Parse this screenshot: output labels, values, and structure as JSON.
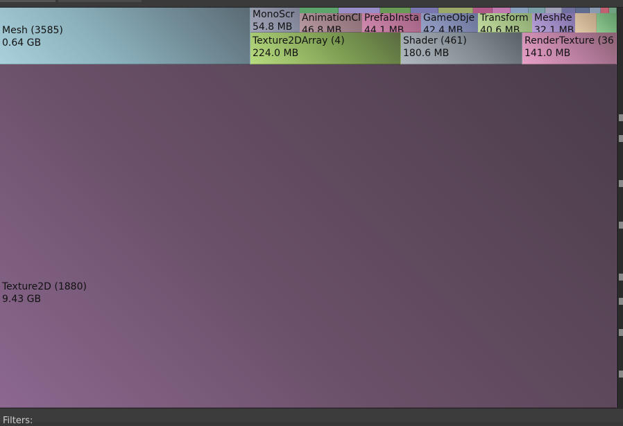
{
  "treemap": {
    "cells": {
      "texture2d": {
        "name": "Texture2D (1880)",
        "size": "9.43 GB"
      },
      "mesh": {
        "name": "Mesh (3585)",
        "size": "0.64 GB"
      },
      "monoscript": {
        "name": "MonoScr",
        "size": "54.8 MB"
      },
      "animationclip": {
        "name": "AnimationCl",
        "size": "46.8 MB"
      },
      "prefabinstance": {
        "name": "PrefabInsta",
        "size": "44.1 MB"
      },
      "gameobject": {
        "name": "GameObje",
        "size": "42.4 MB"
      },
      "transform": {
        "name": "Transform",
        "size": "40.6 MB"
      },
      "meshrenderer": {
        "name": "MeshRe",
        "size": "32.1 MB"
      },
      "texture2darray": {
        "name": "Texture2DArray (4)",
        "size": "224.0 MB"
      },
      "shader": {
        "name": "Shader (461)",
        "size": "180.6 MB"
      },
      "rendertexture": {
        "name": "RenderTexture (36",
        "size": "141.0 MB"
      }
    }
  },
  "footer": {
    "filters_label": "Filters:"
  }
}
